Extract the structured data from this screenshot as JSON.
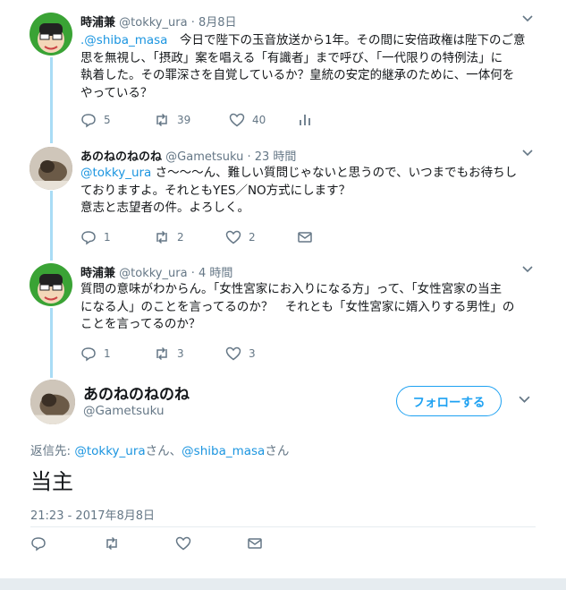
{
  "tweets": [
    {
      "name": "時浦兼",
      "handle": "@tokky_ura",
      "time": "· 8月8日",
      "mention": ".@shiba_masa",
      "lines": [
        "　今日で陛下の玉音放送から1年。その間に安倍政権は陛下のご意",
        "思を無視し、「摂政」案を唱える「有識者」まで呼び、「一代限りの特例法」に",
        "執着した。その罪深さを自覚しているか？皇統の安定的継承のために、一体何を",
        "やっている？"
      ],
      "reply_count": "5",
      "retweet_count": "39",
      "like_count": "40"
    },
    {
      "name": "あのねのねのね",
      "handle": "@Gametsuku",
      "time": "· 23 時間",
      "mention": "@tokky_ura",
      "lines": [
        " さ〜〜〜ん、難しい質問じゃないと思うので、いつまでもお待ちし",
        "ておりますよ。それともYES／NO方式にします？",
        "意志と志望者の件。よろしく。"
      ],
      "reply_count": "1",
      "retweet_count": "2",
      "like_count": "2"
    },
    {
      "name": "時浦兼",
      "handle": "@tokky_ura",
      "time": "· 4 時間",
      "mention": "",
      "lines": [
        "質問の意味がわからん。「女性宮家にお入りになる方」って、「女性宮家の当主",
        "になる人」のことを言ってるのか？　それとも「女性宮家に婿入りする男性」の",
        "ことを言ってるのか？"
      ],
      "reply_count": "1",
      "retweet_count": "3",
      "like_count": "3"
    }
  ],
  "main_tweet": {
    "name": "あのねのねのね",
    "handle": "@Gametsuku",
    "follow_label": "フォローする",
    "reply_to_prefix": "返信先: ",
    "reply_to_user1": "@tokky_ura",
    "reply_to_mid": "さん、",
    "reply_to_user2": "@shiba_masa",
    "reply_to_suffix": "さん",
    "text": "当主",
    "timestamp": "21:23 - 2017年8月8日"
  },
  "colors": {
    "link": "#1b95e0",
    "accent": "#1da1f2",
    "muted": "#657786",
    "thread_line": "#a9dcf5"
  },
  "icons": [
    "reply-icon",
    "retweet-icon",
    "like-icon",
    "analytics-icon",
    "dm-icon",
    "chevron-down-icon"
  ]
}
